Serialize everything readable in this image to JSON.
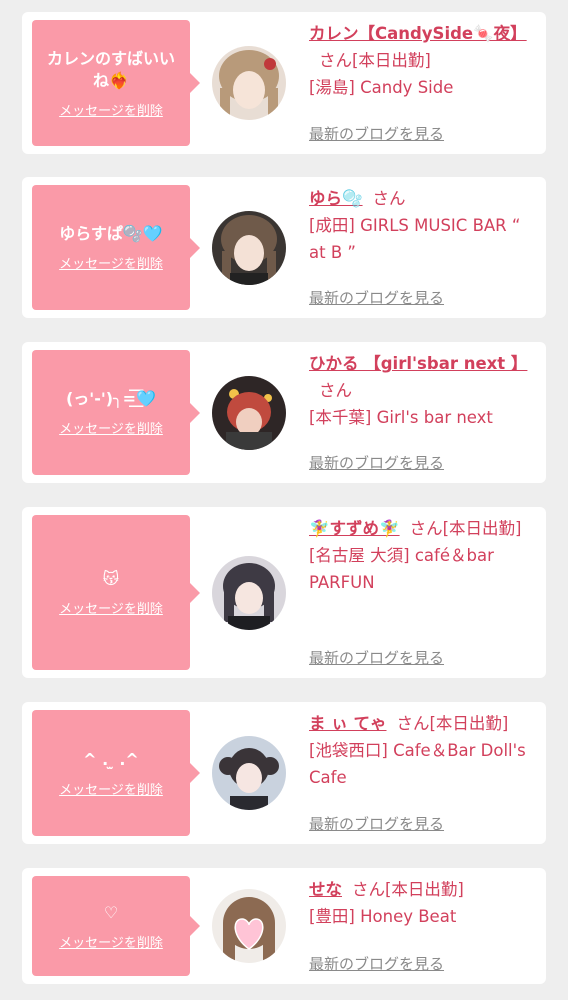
{
  "list": {
    "items": [
      {
        "message": "カレンのすばいいね❤️‍🔥",
        "delete_label": "メッセージを削除",
        "name": "カレン【CandySide🍬夜】",
        "san": "さん",
        "status": "[本日出勤]",
        "shop": "[湯島] Candy Side",
        "blog_link": "最新のブログを見る",
        "avatar_color": "#b89a7a"
      },
      {
        "message": "ゆらすぱ🫧🩵",
        "delete_label": "メッセージを削除",
        "name": "ゆら🫧",
        "san": "さん",
        "status": "",
        "shop": "[成田] GIRLS MUSIC BAR “ at B ”",
        "blog_link": "最新のブログを見る",
        "avatar_color": "#6f5a4a"
      },
      {
        "message": "(っ'-')╮=͟͟͞͞🩵",
        "delete_label": "メッセージを削除",
        "name": "ひかる 【girl'sbar next 】",
        "san": "さん",
        "status": "",
        "shop": "[本千葉] Girl's bar next",
        "blog_link": "最新のブログを見る",
        "avatar_color": "#8a5248"
      },
      {
        "message": "😽",
        "delete_label": "メッセージを削除",
        "name": "🧚‍♀️すずめ🧚‍♀️",
        "san": "さん",
        "status": "[本日出勤]",
        "shop": "[名古屋 大須] café＆bar PARFUN",
        "blog_link": "最新のブログを見る",
        "avatar_color": "#3e3a44"
      },
      {
        "message": "^ . ̫ .^",
        "delete_label": "メッセージを削除",
        "name": "ま ぃ てゃ",
        "san": "さん",
        "status": "[本日出勤]",
        "shop": "[池袋西口] Cafe＆Bar Doll's Cafe",
        "blog_link": "最新のブログを見る",
        "avatar_color": "#6b6f7c"
      },
      {
        "message": "♡",
        "delete_label": "メッセージを削除",
        "name": "せな",
        "san": "さん",
        "status": "[本日出勤]",
        "shop": "[豊田] Honey Beat",
        "blog_link": "最新のブログを見る",
        "avatar_color": "#8c6a52"
      }
    ]
  }
}
